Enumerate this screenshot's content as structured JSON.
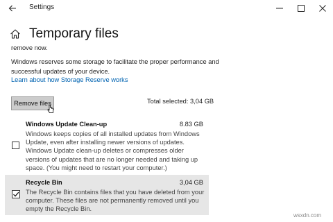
{
  "window": {
    "title": "Settings",
    "controls": {
      "minimize": "minimize-icon",
      "maximize": "maximize-icon",
      "close": "close-icon"
    }
  },
  "page": {
    "title": "Temporary files",
    "intro_tail": "remove now.",
    "reserve_text": "Windows reserves some storage to facilitate the proper performance and successful updates of your device.",
    "reserve_link": "Learn about how Storage Reserve works"
  },
  "actions": {
    "remove_label": "Remove files",
    "total_selected": "Total selected: 3,04 GB"
  },
  "items": [
    {
      "title": "Windows Update Clean-up",
      "size": "8.83 GB",
      "checked": false,
      "description": "Windows keeps copies of all installed updates from Windows Update, even after installing newer versions of updates. Windows Update clean-up deletes or compresses older versions of updates that are no longer needed and taking up space. (You might need to restart your computer.)"
    },
    {
      "title": "Recycle Bin",
      "size": "3,04 GB",
      "checked": true,
      "description": "The Recycle Bin contains files that you have deleted from your computer. These files are not permanently removed until you empty the Recycle Bin."
    }
  ],
  "watermark": "wsxdn.com",
  "colors": {
    "accent_link": "#0063b1",
    "selected_row": "#e6e6e6",
    "button_bg": "#cccccc"
  }
}
